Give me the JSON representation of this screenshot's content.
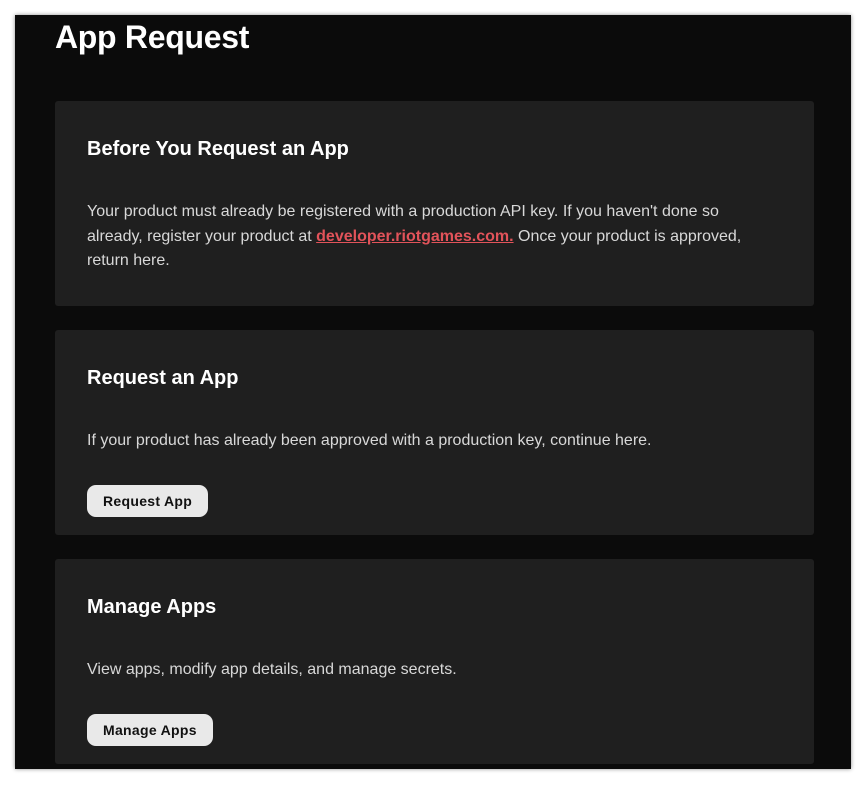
{
  "page": {
    "title": "App Request"
  },
  "cards": [
    {
      "heading": "Before You Request an App",
      "text_before_link": "Your product must already be registered with a production API key. If you haven't done so already, register your product at ",
      "link_text": "developer.riotgames.com.",
      "text_after_link": " Once your product is approved, return here."
    },
    {
      "heading": "Request an App",
      "text": "If your product has already been approved with a production key, continue here.",
      "button_label": "Request App"
    },
    {
      "heading": "Manage Apps",
      "text": "View apps, modify app details, and manage secrets.",
      "button_label": "Manage Apps"
    }
  ],
  "colors": {
    "background": "#0b0b0b",
    "card": "#1f1f1f",
    "link": "#e2535a",
    "button": "#e9e9e9"
  }
}
